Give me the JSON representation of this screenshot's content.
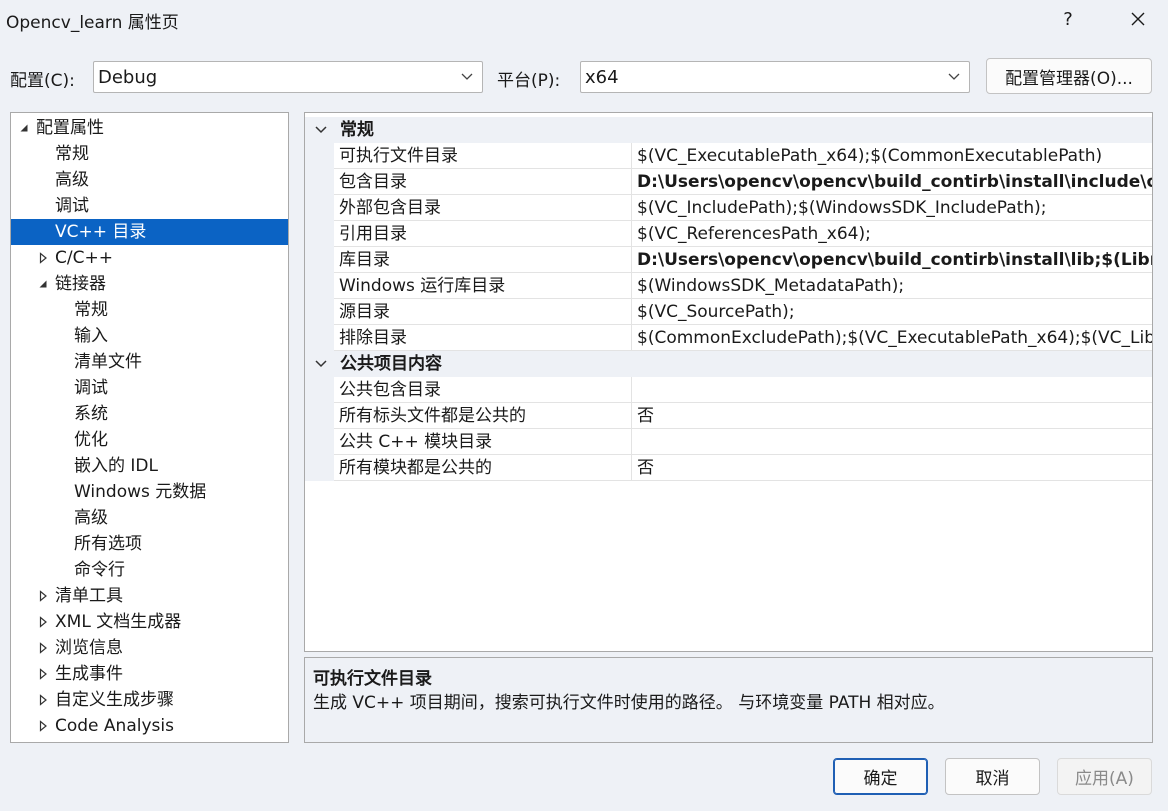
{
  "window": {
    "title": "Opencv_learn 属性页",
    "help": "?"
  },
  "config": {
    "label": "配置(C):",
    "value": "Debug",
    "platform_label": "平台(P):",
    "platform_value": "x64",
    "manager_button": "配置管理器(O)..."
  },
  "tree": {
    "items": [
      {
        "label": "配置属性",
        "level": 0,
        "toggle": "expanded"
      },
      {
        "label": "常规",
        "level": 1,
        "toggle": "none"
      },
      {
        "label": "高级",
        "level": 1,
        "toggle": "none"
      },
      {
        "label": "调试",
        "level": 1,
        "toggle": "none"
      },
      {
        "label": "VC++ 目录",
        "level": 1,
        "toggle": "none",
        "selected": true
      },
      {
        "label": "C/C++",
        "level": 1,
        "toggle": "collapsed"
      },
      {
        "label": "链接器",
        "level": 1,
        "toggle": "expanded"
      },
      {
        "label": "常规",
        "level": 2,
        "toggle": "none"
      },
      {
        "label": "输入",
        "level": 2,
        "toggle": "none"
      },
      {
        "label": "清单文件",
        "level": 2,
        "toggle": "none"
      },
      {
        "label": "调试",
        "level": 2,
        "toggle": "none"
      },
      {
        "label": "系统",
        "level": 2,
        "toggle": "none"
      },
      {
        "label": "优化",
        "level": 2,
        "toggle": "none"
      },
      {
        "label": "嵌入的 IDL",
        "level": 2,
        "toggle": "none"
      },
      {
        "label": "Windows 元数据",
        "level": 2,
        "toggle": "none"
      },
      {
        "label": "高级",
        "level": 2,
        "toggle": "none"
      },
      {
        "label": "所有选项",
        "level": 2,
        "toggle": "none"
      },
      {
        "label": "命令行",
        "level": 2,
        "toggle": "none"
      },
      {
        "label": "清单工具",
        "level": 1,
        "toggle": "collapsed"
      },
      {
        "label": "XML 文档生成器",
        "level": 1,
        "toggle": "collapsed"
      },
      {
        "label": "浏览信息",
        "level": 1,
        "toggle": "collapsed"
      },
      {
        "label": "生成事件",
        "level": 1,
        "toggle": "collapsed"
      },
      {
        "label": "自定义生成步骤",
        "level": 1,
        "toggle": "collapsed"
      },
      {
        "label": "Code Analysis",
        "level": 1,
        "toggle": "collapsed"
      }
    ]
  },
  "grid": {
    "groups": [
      {
        "title": "常规",
        "rows": [
          {
            "name": "可执行文件目录",
            "value": "$(VC_ExecutablePath_x64);$(CommonExecutablePath)",
            "bold": false
          },
          {
            "name": "包含目录",
            "value": "D:\\Users\\opencv\\opencv\\build_contirb\\install\\include\\op",
            "bold": true
          },
          {
            "name": "外部包含目录",
            "value": "$(VC_IncludePath);$(WindowsSDK_IncludePath);",
            "bold": false
          },
          {
            "name": "引用目录",
            "value": "$(VC_ReferencesPath_x64);",
            "bold": false
          },
          {
            "name": "库目录",
            "value": "D:\\Users\\opencv\\opencv\\build_contirb\\install\\lib;$(Librar",
            "bold": true
          },
          {
            "name": "Windows 运行库目录",
            "value": "$(WindowsSDK_MetadataPath);",
            "bold": false
          },
          {
            "name": "源目录",
            "value": "$(VC_SourcePath);",
            "bold": false
          },
          {
            "name": "排除目录",
            "value": "$(CommonExcludePath);$(VC_ExecutablePath_x64);$(VC_Lib",
            "bold": false
          }
        ]
      },
      {
        "title": "公共项目内容",
        "rows": [
          {
            "name": "公共包含目录",
            "value": "",
            "bold": false
          },
          {
            "name": "所有标头文件都是公共的",
            "value": "否",
            "bold": false
          },
          {
            "name": "公共 C++ 模块目录",
            "value": "",
            "bold": false
          },
          {
            "name": "所有模块都是公共的",
            "value": "否",
            "bold": false
          }
        ]
      }
    ]
  },
  "description": {
    "title": "可执行文件目录",
    "text": "生成 VC++ 项目期间，搜索可执行文件时使用的路径。 与环境变量 PATH 相对应。"
  },
  "buttons": {
    "ok": "确定",
    "cancel": "取消",
    "apply": "应用(A)"
  },
  "icons": {
    "close": "close-icon",
    "dropdown": "chevron-down-icon",
    "tree_expanded": "triangle-expanded-icon",
    "tree_collapsed": "triangle-collapsed-icon",
    "group_collapse": "chevron-down-icon"
  },
  "colors": {
    "selection": "#0b63c4",
    "background": "#eef1f6",
    "primary_border": "#1f5fb4"
  }
}
